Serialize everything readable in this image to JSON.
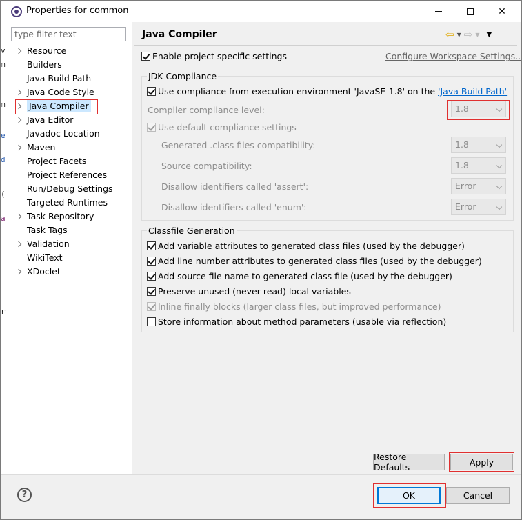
{
  "window": {
    "title": "Properties for common"
  },
  "filter": {
    "placeholder": "type filter text"
  },
  "tree": [
    {
      "label": "Resource",
      "expandable": true
    },
    {
      "label": "Builders",
      "expandable": false
    },
    {
      "label": "Java Build Path",
      "expandable": false
    },
    {
      "label": "Java Code Style",
      "expandable": true
    },
    {
      "label": "Java Compiler",
      "expandable": true,
      "selected": true
    },
    {
      "label": "Java Editor",
      "expandable": true
    },
    {
      "label": "Javadoc Location",
      "expandable": false
    },
    {
      "label": "Maven",
      "expandable": true
    },
    {
      "label": "Project Facets",
      "expandable": false
    },
    {
      "label": "Project References",
      "expandable": false
    },
    {
      "label": "Run/Debug Settings",
      "expandable": false
    },
    {
      "label": "Targeted Runtimes",
      "expandable": false
    },
    {
      "label": "Task Repository",
      "expandable": true
    },
    {
      "label": "Task Tags",
      "expandable": false
    },
    {
      "label": "Validation",
      "expandable": true
    },
    {
      "label": "WikiText",
      "expandable": false
    },
    {
      "label": "XDoclet",
      "expandable": true
    }
  ],
  "page": {
    "title": "Java Compiler",
    "enable_project_specific": {
      "label": "Enable project specific settings",
      "checked": true
    },
    "configure_workspace_link": "Configure Workspace Settings...",
    "jdk_group": {
      "label": "JDK Compliance",
      "use_compliance_prefix": "Use compliance from execution environment 'JavaSE-1.8' on the ",
      "use_compliance_link": "'Java Build Path'",
      "use_compliance_checked": true,
      "compliance_level_label": "Compiler compliance level:",
      "compliance_level_value": "1.8",
      "use_default_label": "Use default compliance settings",
      "use_default_checked": true,
      "generated_label": "Generated .class files compatibility:",
      "generated_value": "1.8",
      "source_label": "Source compatibility:",
      "source_value": "1.8",
      "assert_label": "Disallow identifiers called 'assert':",
      "assert_value": "Error",
      "enum_label": "Disallow identifiers called 'enum':",
      "enum_value": "Error"
    },
    "classfile_group": {
      "label": "Classfile Generation",
      "options": [
        {
          "label": "Add variable attributes to generated class files (used by the debugger)",
          "checked": true,
          "disabled": false
        },
        {
          "label": "Add line number attributes to generated class files (used by the debugger)",
          "checked": true,
          "disabled": false
        },
        {
          "label": "Add source file name to generated class file (used by the debugger)",
          "checked": true,
          "disabled": false
        },
        {
          "label": "Preserve unused (never read) local variables",
          "checked": true,
          "disabled": false
        },
        {
          "label": "Inline finally blocks (larger class files, but improved performance)",
          "checked": true,
          "disabled": true
        },
        {
          "label": "Store information about method parameters (usable via reflection)",
          "checked": false,
          "disabled": false
        }
      ]
    },
    "restore_defaults": "Restore Defaults",
    "apply": "Apply"
  },
  "footer": {
    "help": "?",
    "ok": "OK",
    "cancel": "Cancel"
  },
  "background_sliver": [
    "v",
    "m",
    "m",
    "e",
    "d",
    "(",
    "a",
    "r"
  ],
  "colors": {
    "selection": "#cce8ff",
    "highlight_outline": "#e03030",
    "link": "#0066cc",
    "default_button_border": "#0078d7"
  }
}
